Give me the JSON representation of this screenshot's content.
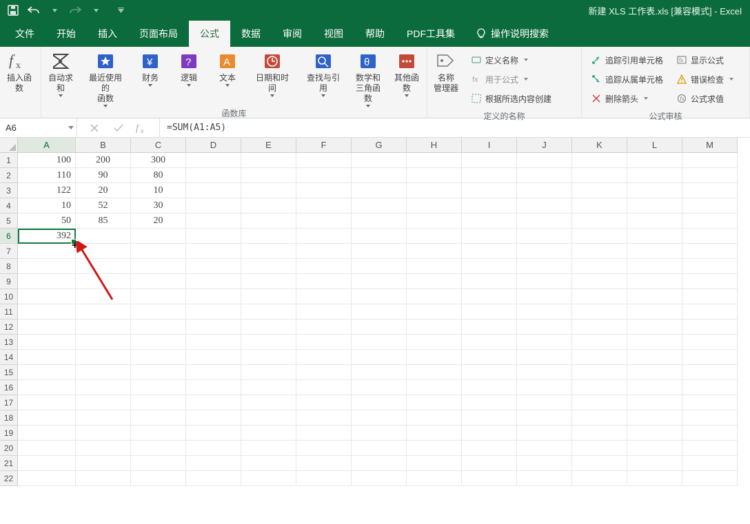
{
  "titlebar": {
    "doc_title": "新建 XLS 工作表.xls  [兼容模式]  -  Excel"
  },
  "tabs": {
    "file": "文件",
    "home": "开始",
    "insert": "插入",
    "layout": "页面布局",
    "formulas": "公式",
    "data": "数据",
    "review": "审阅",
    "view": "视图",
    "help": "帮助",
    "pdf": "PDF工具集",
    "tellme": "操作说明搜索"
  },
  "ribbon": {
    "insert_fn": "插入函数",
    "autosum": "自动求和",
    "recent": "最近使用的\n函数",
    "financial": "财务",
    "logical": "逻辑",
    "text": "文本",
    "datetime": "日期和时间",
    "lookup": "查找与引用",
    "mathtrig": "数学和\n三角函数",
    "more": "其他函数",
    "group_lib": "函数库",
    "name_mgr": "名称\n管理器",
    "define_name": "定义名称",
    "use_in_formula": "用于公式",
    "from_selection": "根据所选内容创建",
    "group_defined": "定义的名称",
    "trace_prec": "追踪引用单元格",
    "trace_dep": "追踪从属单元格",
    "remove_arrows": "删除箭头",
    "show_formulas": "显示公式",
    "error_check": "错误检查",
    "evaluate": "公式求值",
    "group_audit": "公式审核"
  },
  "fx": {
    "nameref": "A6",
    "formula": "=SUM(A1:A5)"
  },
  "columns": [
    "A",
    "B",
    "C",
    "D",
    "E",
    "F",
    "G",
    "H",
    "I",
    "J",
    "K",
    "L",
    "M"
  ],
  "rows22": [
    "1",
    "2",
    "3",
    "4",
    "5",
    "6",
    "7",
    "8",
    "9",
    "10",
    "11",
    "12",
    "13",
    "14",
    "15",
    "16",
    "17",
    "18",
    "19",
    "20",
    "21",
    "22"
  ],
  "gridvals": {
    "a": [
      "100",
      "110",
      "122",
      "10",
      "50",
      "392"
    ],
    "b": [
      "200",
      "90",
      "20",
      "52",
      "85"
    ],
    "c": [
      "300",
      "80",
      "10",
      "30",
      "20"
    ]
  },
  "chart_data": {
    "type": "table",
    "columns": [
      "A",
      "B",
      "C"
    ],
    "rows": [
      [
        100,
        200,
        300
      ],
      [
        110,
        90,
        80
      ],
      [
        122,
        20,
        10
      ],
      [
        10,
        52,
        30
      ],
      [
        50,
        85,
        20
      ],
      [
        392,
        null,
        null
      ]
    ],
    "active_cell": "A6",
    "active_cell_formula": "=SUM(A1:A5)"
  }
}
